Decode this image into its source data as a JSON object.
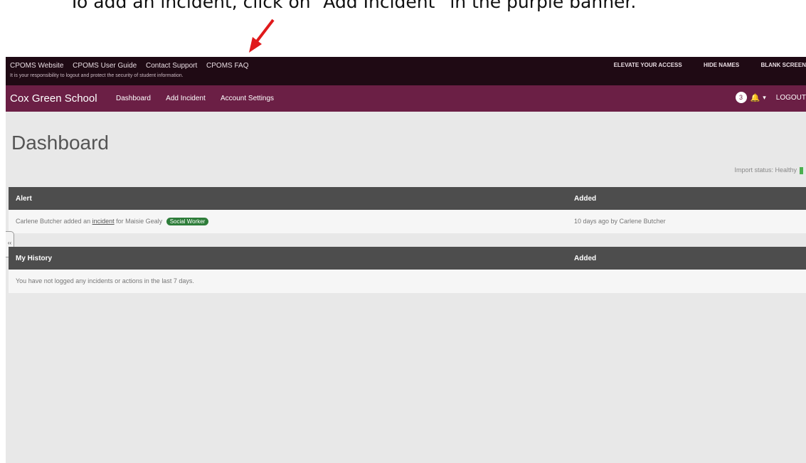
{
  "caption": {
    "text": "To add an incident, click on “Add Incident” in the purple banner."
  },
  "topbar": {
    "links": [
      "CPOMS Website",
      "CPOMS User Guide",
      "Contact Support",
      "CPOMS FAQ"
    ],
    "note": "It is your responsibility to logout and protect the security of student information.",
    "right": [
      "ELEVATE YOUR ACCESS",
      "HIDE NAMES",
      "BLANK SCREEN"
    ]
  },
  "navbar": {
    "brand": "Cox Green School",
    "links": [
      "Dashboard",
      "Add Incident",
      "Account Settings"
    ],
    "notification_count": "3",
    "logout": "LOGOUT"
  },
  "page": {
    "title": "Dashboard",
    "import_status": "Import status: Healthy"
  },
  "alerts": {
    "headers": {
      "alert": "Alert",
      "added": "Added"
    },
    "row": {
      "prefix": "Carlene Butcher added an",
      "link": "incident",
      "suffix": "for Maisie Gealy",
      "badge": "Social Worker",
      "added": "10 days ago by Carlene Butcher"
    }
  },
  "history": {
    "headers": {
      "history": "My History",
      "added": "Added"
    },
    "empty": "You have not logged any incidents or actions in the last 7 days."
  },
  "colors": {
    "topbar": "#1f0a14",
    "navbar": "#6b1f45",
    "table_header": "#4d4d4d",
    "arrow": "#e0191b"
  },
  "icons": [
    "bell-icon",
    "caret-down-icon",
    "arrow-icon",
    "collapse-handle-icon"
  ]
}
